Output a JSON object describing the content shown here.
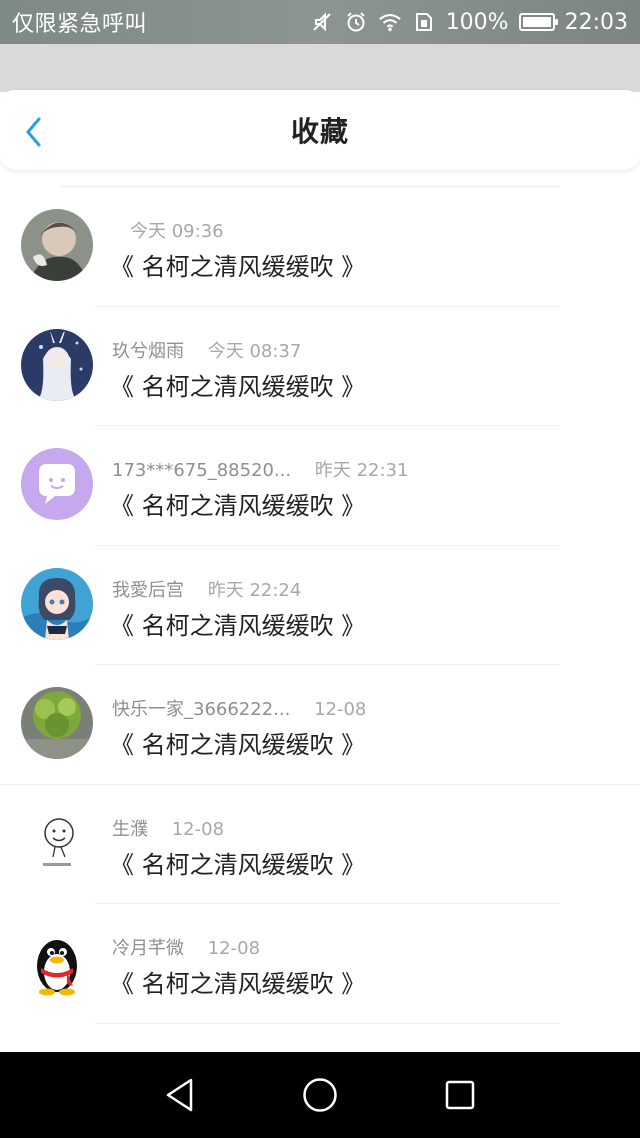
{
  "status_bar": {
    "left_text": "仅限紧急呼叫",
    "battery_percent": "100%",
    "battery_level": 1.0,
    "time": "22:03",
    "icons": [
      "mute-icon",
      "alarm-icon",
      "wifi-icon",
      "sim-icon",
      "battery-icon"
    ]
  },
  "header": {
    "title": "收藏",
    "back_icon": "chevron-left-icon",
    "accent_color": "#2a9fe6"
  },
  "favorites": [
    {
      "user": "",
      "time": "今天 09:36",
      "title": "《 名柯之清风缓缓吹 》"
    },
    {
      "user": "玖兮烟雨",
      "time": "今天 08:37",
      "title": "《 名柯之清风缓缓吹 》"
    },
    {
      "user": "173***675_88520...",
      "time": "昨天 22:31",
      "title": "《 名柯之清风缓缓吹 》"
    },
    {
      "user": "我愛后宫",
      "time": "昨天 22:24",
      "title": "《 名柯之清风缓缓吹 》"
    },
    {
      "user": "快乐一家_3666222...",
      "time": "12-08",
      "title": "《 名柯之清风缓缓吹 》"
    },
    {
      "user": "生濮",
      "time": "12-08",
      "title": "《 名柯之清风缓缓吹 》"
    },
    {
      "user": "冷月芊微",
      "time": "12-08",
      "title": "《 名柯之清风缓缓吹 》"
    }
  ],
  "nav_bar": {
    "icons": [
      "back-triangle-icon",
      "home-circle-icon",
      "recents-square-icon"
    ]
  }
}
